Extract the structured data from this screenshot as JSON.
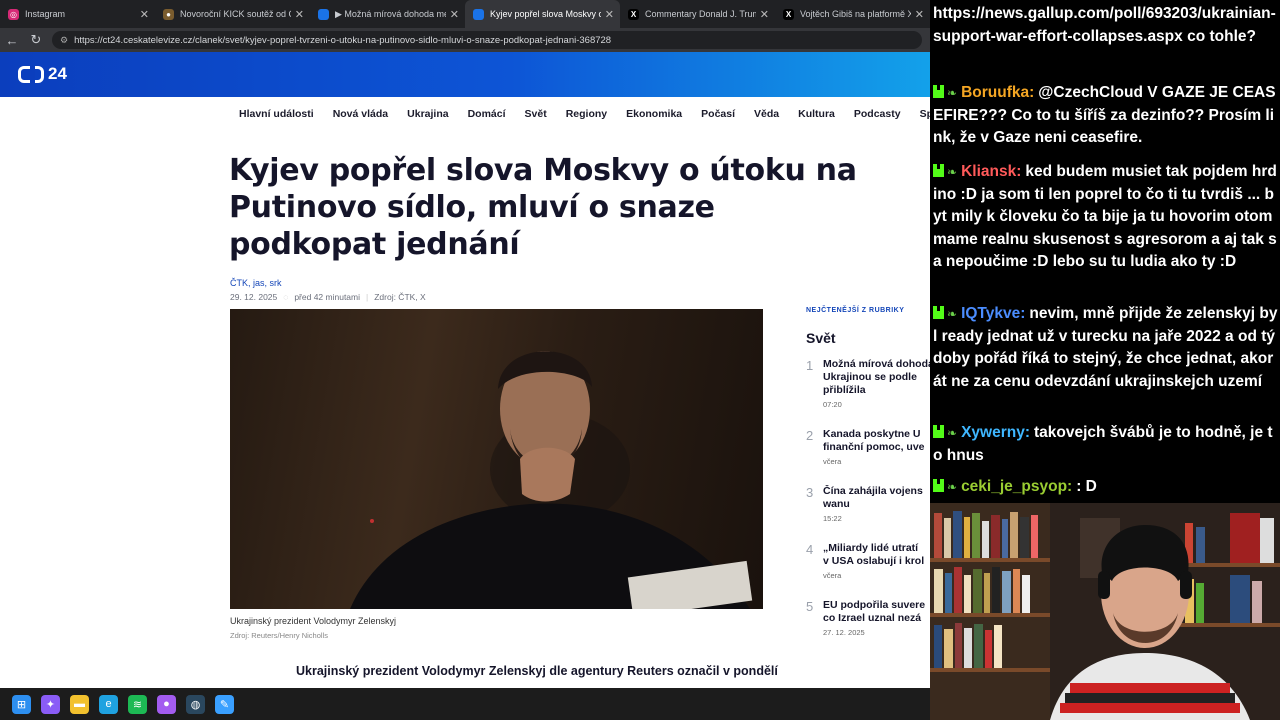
{
  "tabs": [
    {
      "title": "Instagram",
      "color": "#d62976",
      "glyph": "◎",
      "active": false
    },
    {
      "title": "Novoroční KICK soutěž od CzechC",
      "color": "#7a5c2e",
      "glyph": "●",
      "active": false
    },
    {
      "title": "▶ Možná mírová dohoda mezi Ru",
      "color": "#1a73e8",
      "glyph": "",
      "active": false
    },
    {
      "title": "Kyjev popřel slova Moskvy o útoku",
      "color": "#1a73e8",
      "glyph": "",
      "active": true
    },
    {
      "title": "Commentary Donald J. Trump Pos",
      "color": "#000000",
      "glyph": "X",
      "active": false
    },
    {
      "title": "Vojtěch Gibiš na platformě X:",
      "color": "#000000",
      "glyph": "X",
      "active": false
    }
  ],
  "url": "https://ct24.ceskatelevize.cz/clanek/svet/kyjev-poprel-tvrzeni-o-utoku-na-putinovo-sidlo-mluvi-o-snaze-podkopat-jednani-368728",
  "site": {
    "logo_text": "24",
    "nav": [
      "Hlavní události",
      "Nová vláda",
      "Ukrajina",
      "Domácí",
      "Svět",
      "Regiony",
      "Ekonomika",
      "Počasí",
      "Věda",
      "Kultura",
      "Podcasty",
      "Sp"
    ]
  },
  "article": {
    "headline": "Kyjev popřel slova Moskvy o útoku na Putinovo sídlo, mluví o snaze podkopat jednání",
    "authors": "ČTK, jas, srk",
    "date": "29. 12. 2025",
    "ago": "před 42 minutami",
    "source": "Zdroj: ČTK, X",
    "caption": "Ukrajinský prezident Volodymyr Zelenskyj",
    "credit": "Zdroj: Reuters/Henry Nicholls",
    "lead": "Ukrajinský prezident Volodymyr Zelenskyj dle agentury Reuters označil v pondělí"
  },
  "sidebar": {
    "title": "NEJČTENĚJŠÍ Z RUBRIKY",
    "section": "Svět",
    "items": [
      {
        "num": "1",
        "title": "Možná mírová dohoda\nUkrajinou se podle\npřiblížila",
        "date": "07:20"
      },
      {
        "num": "2",
        "title": "Kanada poskytne U\nfinanční pomoc, uve",
        "date": "včera"
      },
      {
        "num": "3",
        "title": "Čína zahájila vojens\nwanu",
        "date": "15:22"
      },
      {
        "num": "4",
        "title": "„Miliardy lidé utratí\nv USA oslabují i krol",
        "date": "včera"
      },
      {
        "num": "5",
        "title": "EU podpořila suvere\nco Izrael uznal nezá",
        "date": "27. 12. 2025"
      }
    ]
  },
  "chat": {
    "messages": [
      {
        "user": "",
        "color": "#ffffff",
        "text": "https://news.gallup.com/poll/693203/ukrainian-support-war-effort-collapses.aspx co tohle?",
        "badge": false
      },
      {
        "user": "Boruufka:",
        "color": "#f5a623",
        "text": "@CzechCloud V GAZE JE CEASEFIRE??? Co to tu šíříš za dezinfo?? Prosím link, že v Gaze neni ceasefire.",
        "badge": true
      },
      {
        "user": "Kliansk:",
        "color": "#ff5a5a",
        "text": "ked budem musiet tak pojdem hrdino :D ja som ti len poprel to čo ti tu tvrdiš ... byt mily k človeku čo ta bije ja tu hovorim otom mame realnu skusenost s agresorom a aj tak sa nepoučime :D lebo su tu ludia ako ty :D",
        "badge": true
      },
      {
        "user": "IQTykve:",
        "color": "#4b8dff",
        "text": "nevim, mně přijde že zelenskyj byl ready jednat už v turecku na jaře 2022 a od tý doby pořád říká to stejný, že chce jednat, akorát ne za cenu odevzdání ukrajinskejch uzemí",
        "badge": true
      },
      {
        "user": "Xywerny:",
        "color": "#3fb7ff",
        "text": "takovejch švábů je to hodně, je to hnus",
        "badge": true
      },
      {
        "user": "ceki_je_psyop:",
        "color": "#9acd32",
        "text": ": D",
        "badge": true
      }
    ]
  },
  "taskbar": [
    {
      "name": "windows-start-icon",
      "color": "#2d8ff0",
      "glyph": "⊞"
    },
    {
      "name": "copilot-icon",
      "color": "#8a5cf6",
      "glyph": "✦"
    },
    {
      "name": "file-explorer-icon",
      "color": "#f2c12e",
      "glyph": "▬"
    },
    {
      "name": "edge-icon",
      "color": "#1fa2e0",
      "glyph": "e"
    },
    {
      "name": "spotify-icon",
      "color": "#1db954",
      "glyph": "≋"
    },
    {
      "name": "messenger-icon",
      "color": "#a35cf0",
      "glyph": "●"
    },
    {
      "name": "steam-icon",
      "color": "#2a475e",
      "glyph": "◍"
    },
    {
      "name": "paint-icon",
      "color": "#3aa0ff",
      "glyph": "✎"
    }
  ]
}
